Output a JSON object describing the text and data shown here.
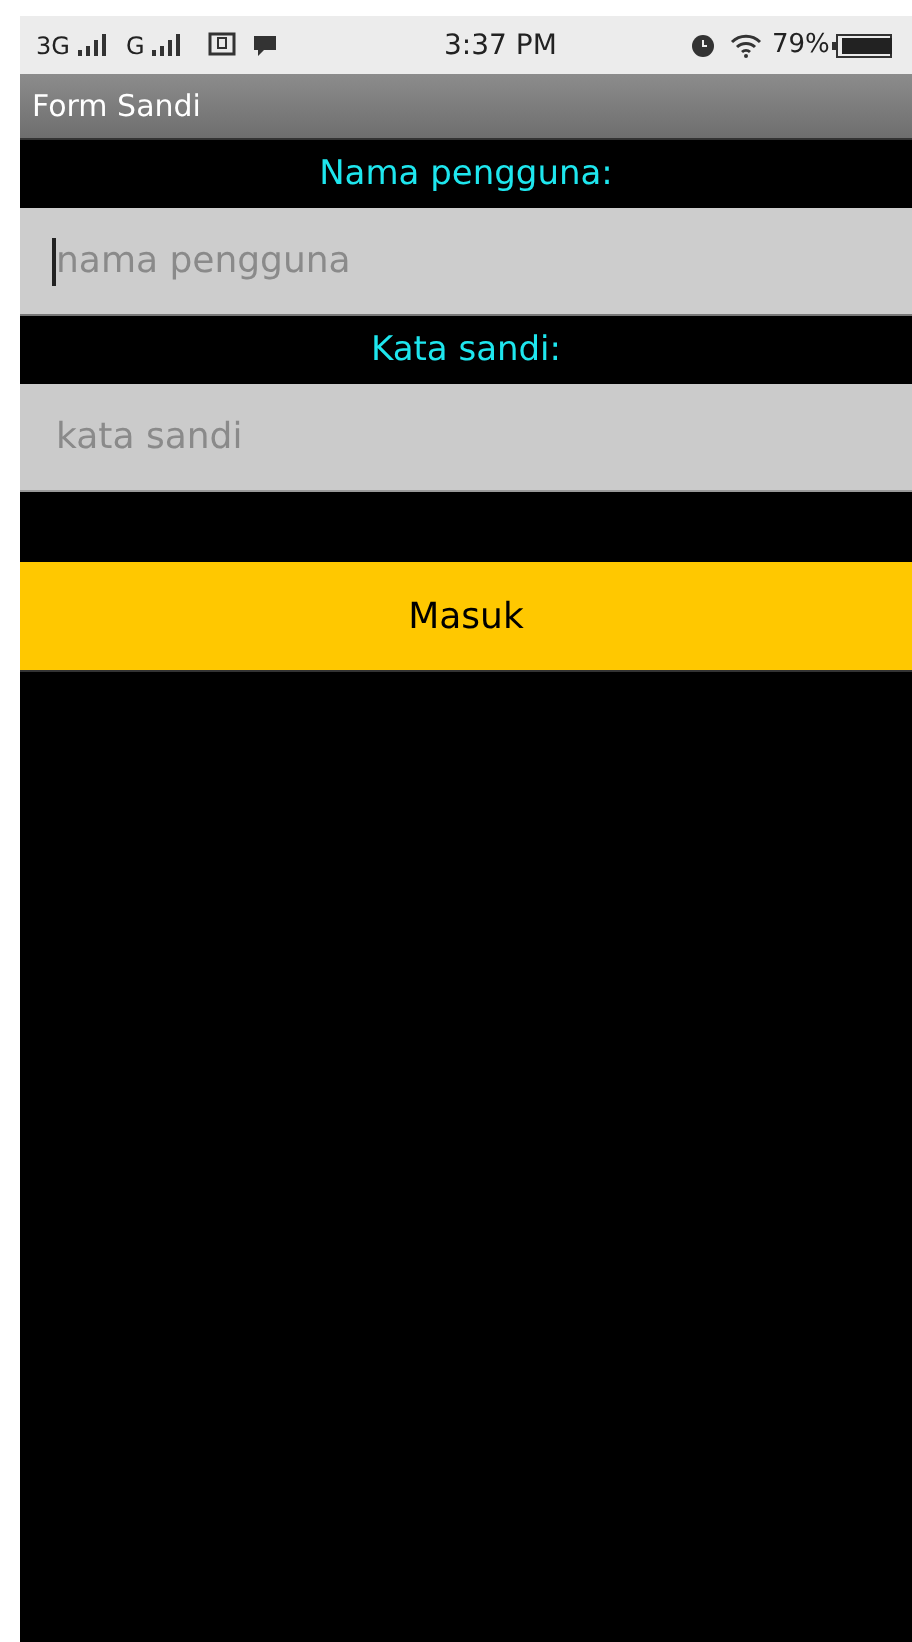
{
  "status_bar": {
    "network_1": "3G",
    "network_2": "G",
    "time": "3:37 PM",
    "battery": "79%"
  },
  "app_bar": {
    "title": "Form Sandi"
  },
  "fields": [
    {
      "label": "Nama pengguna:",
      "placeholder": "nama pengguna",
      "focused": true
    },
    {
      "label": "Kata sandi:",
      "placeholder": "kata sandi",
      "focused": false
    }
  ],
  "button": {
    "label": "Masuk"
  }
}
